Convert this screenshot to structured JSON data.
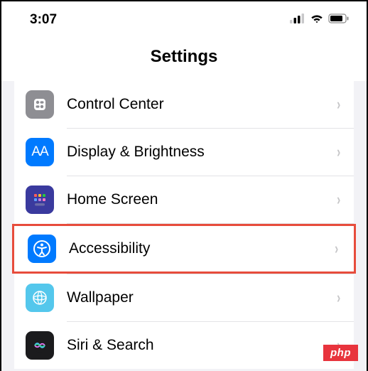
{
  "status": {
    "time": "3:07"
  },
  "title": "Settings",
  "rows": [
    {
      "label": "Control Center",
      "icon": "control-center-icon"
    },
    {
      "label": "Display & Brightness",
      "icon": "display-icon"
    },
    {
      "label": "Home Screen",
      "icon": "home-screen-icon"
    },
    {
      "label": "Accessibility",
      "icon": "accessibility-icon",
      "highlighted": true
    },
    {
      "label": "Wallpaper",
      "icon": "wallpaper-icon"
    },
    {
      "label": "Siri & Search",
      "icon": "siri-icon"
    }
  ],
  "watermark": "php"
}
